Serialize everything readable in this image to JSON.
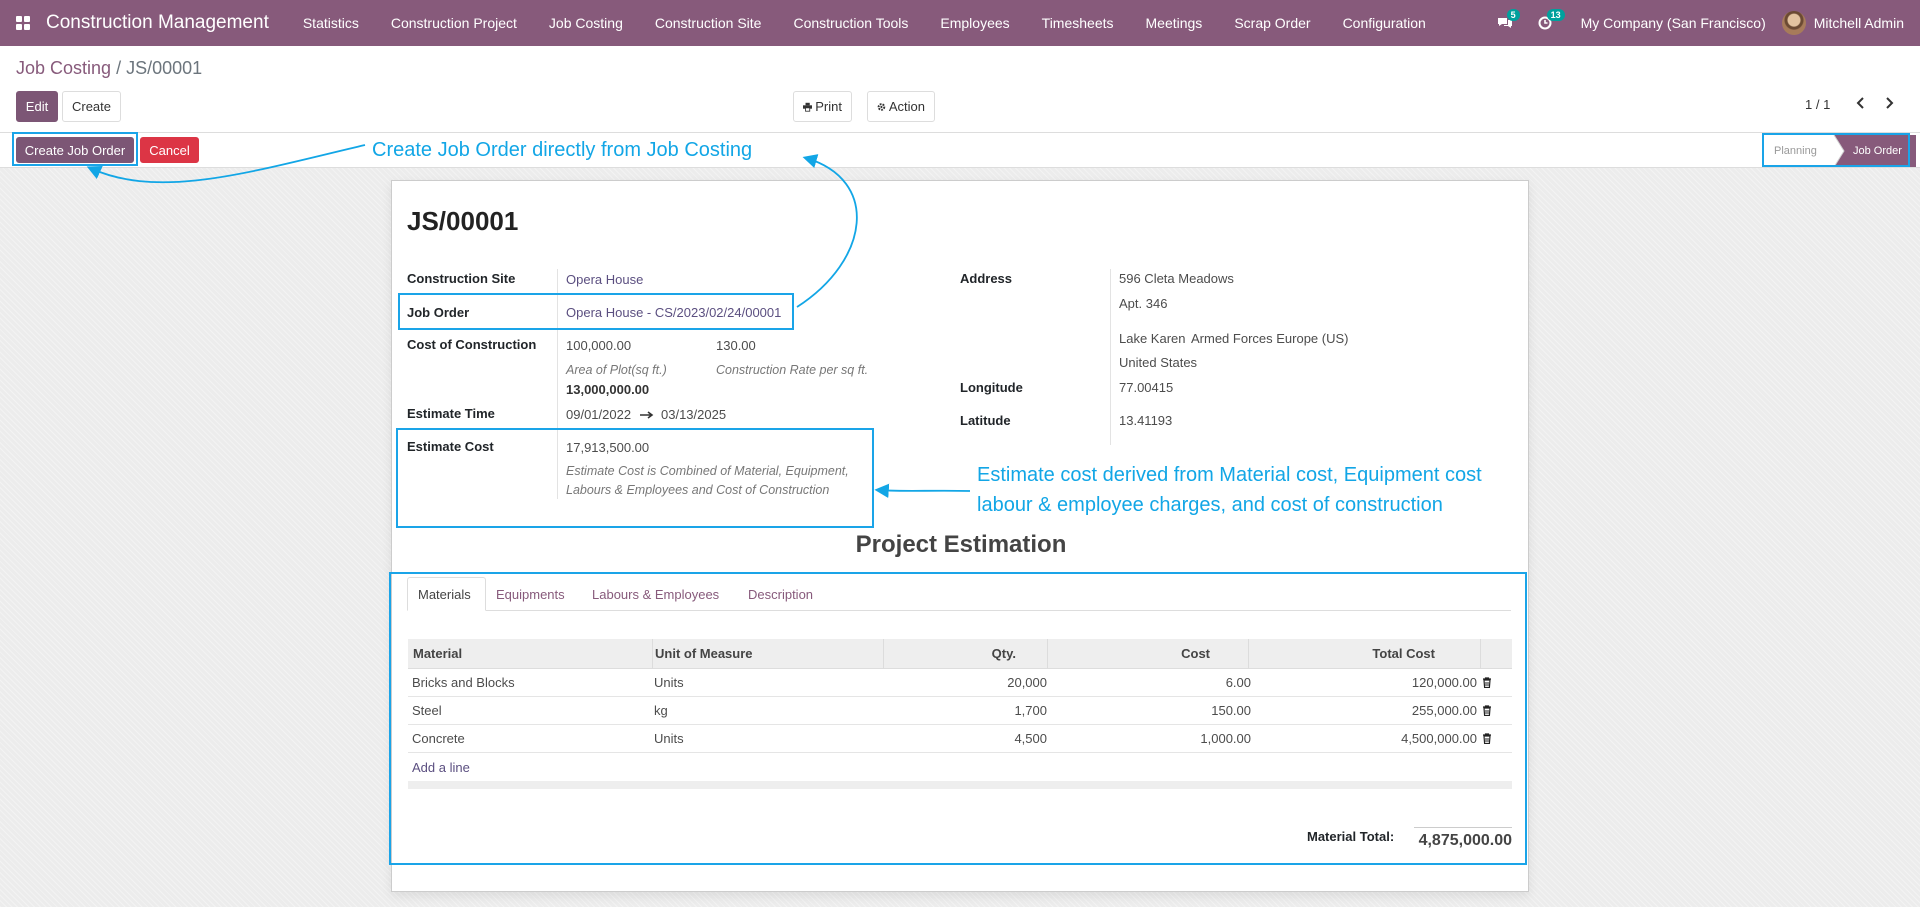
{
  "navbar": {
    "app_title": "Construction Management",
    "menu": [
      "Statistics",
      "Construction Project",
      "Job Costing",
      "Construction Site",
      "Construction Tools",
      "Employees",
      "Timesheets",
      "Meetings",
      "Scrap Order",
      "Configuration"
    ],
    "messages_badge": "5",
    "activities_badge": "13",
    "company": "My Company (San Francisco)",
    "user": "Mitchell Admin",
    "accent_color": "#875a7b"
  },
  "breadcrumb": {
    "parent": "Job Costing",
    "current": "/ JS/00001"
  },
  "buttons": {
    "edit": "Edit",
    "create": "Create",
    "print": "Print",
    "action": "Action",
    "create_job_order": "Create Job Order",
    "cancel": "Cancel"
  },
  "pager": {
    "value": "1 / 1"
  },
  "statusbar": {
    "stages": [
      "Planning",
      "Job Order"
    ],
    "active_stage": "Job Order"
  },
  "record": {
    "name": "JS/00001",
    "construction_site_label": "Construction Site",
    "construction_site": "Opera House",
    "job_order_label": "Job Order",
    "job_order": "Opera House - CS/2023/02/24/00001",
    "cost_of_construction_label": "Cost of Construction",
    "area_of_plot": "100,000.00",
    "area_of_plot_help": "Area of Plot(sq ft.)",
    "construction_rate": "130.00",
    "construction_rate_help": "Construction Rate per sq ft.",
    "cost_of_construction": "13,000,000.00",
    "estimate_time_label": "Estimate Time",
    "estimate_start": "09/01/2022",
    "estimate_end": "03/13/2025",
    "estimate_cost_label": "Estimate Cost",
    "estimate_cost": "17,913,500.00",
    "estimate_cost_help_line1": "Estimate Cost is Combined of Material, Equipment,",
    "estimate_cost_help_line2": "Labours & Employees and Cost of Construction",
    "address_label": "Address",
    "address_line1": "596 Cleta Meadows",
    "address_line2": "Apt. 346",
    "city": "Lake Karen",
    "state": "Armed Forces Europe (US)",
    "country": "United States",
    "longitude_label": "Longitude",
    "longitude": "77.00415",
    "latitude_label": "Latitude",
    "latitude": "13.41193"
  },
  "section_title": "Project Estimation",
  "tabs": [
    "Materials",
    "Equipments",
    "Labours & Employees",
    "Description"
  ],
  "table": {
    "headers": [
      "Material",
      "Unit of Measure",
      "Qty.",
      "Cost",
      "Total Cost"
    ],
    "rows": [
      [
        "Bricks and Blocks",
        "Units",
        "20,000",
        "6.00",
        "120,000.00"
      ],
      [
        "Steel",
        "kg",
        "1,700",
        "150.00",
        "255,000.00"
      ],
      [
        "Concrete",
        "Units",
        "4,500",
        "1,000.00",
        "4,500,000.00"
      ]
    ],
    "add_line": "Add a line"
  },
  "totals": {
    "label": "Material Total:",
    "value": "4,875,000.00"
  },
  "annotations": {
    "create_job_order": "Create Job Order directly from Job Costing",
    "estimate_line1": "Estimate cost derived from Material cost, Equipment cost",
    "estimate_line2": "labour & employee charges, and cost of construction",
    "color": "#12a6e6"
  }
}
